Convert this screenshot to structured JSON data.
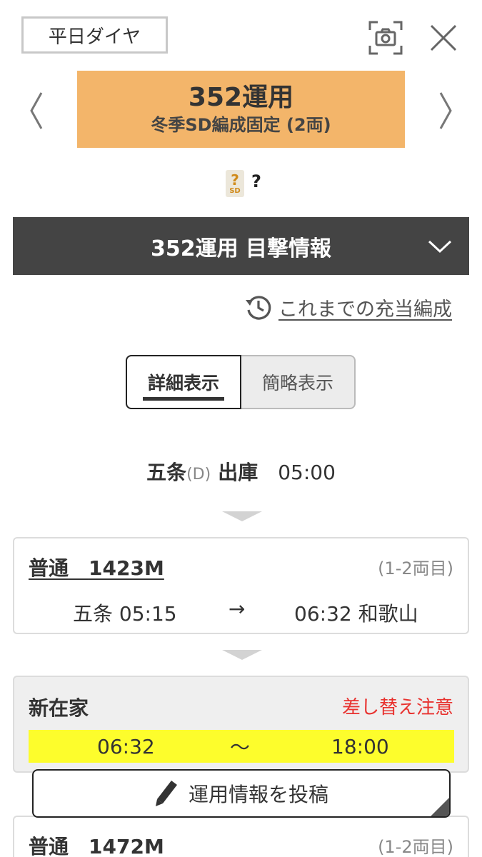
{
  "top_bar": {
    "schedule_label": "平日ダイヤ",
    "screenshot_icon": "camera-icon",
    "close_icon": "close-icon"
  },
  "header": {
    "prev_icon": "chevron-left-icon",
    "next_icon": "chevron-right-icon",
    "operation_title": "352運用",
    "operation_subtitle": "冬季SD編成固定 (2両)",
    "accent_color": "#f3b56a"
  },
  "formation": {
    "badge_mark": "?",
    "badge_sub": "SD",
    "label": "?"
  },
  "sighting_bar": {
    "title": "352運用 目撃情報",
    "icon": "chevron-down-icon",
    "bg_color": "#444444"
  },
  "history_link": {
    "icon": "history-clock-icon",
    "label": "これまでの充当編成"
  },
  "view_toggle": {
    "detail_label": "詳細表示",
    "simple_label": "簡略表示",
    "selected": "詳細表示"
  },
  "depot": {
    "station": "五条",
    "station_code": "(D)",
    "action": "出庫",
    "time": "05:00"
  },
  "trains": [
    {
      "type": "普通",
      "number": "1423M",
      "cars": "(1-2両目)",
      "from": "五条 05:15",
      "arrow": "→",
      "to": "06:32 和歌山"
    },
    {
      "type": "普通",
      "number": "1472M",
      "cars": "(1-2両目)"
    }
  ],
  "stay": {
    "station": "新在家",
    "warning": "差し替え注意",
    "start": "06:32",
    "tilde": "〜",
    "end": "18:00",
    "highlight_color": "#fdfd2c",
    "warning_color": "#e8322f"
  },
  "post_button": {
    "icon": "pencil-icon",
    "label": "運用情報を投稿"
  }
}
